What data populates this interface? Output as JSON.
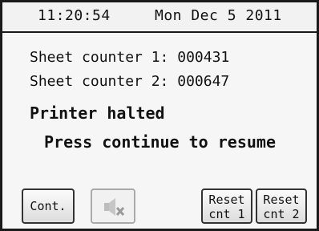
{
  "header": {
    "time": "11:20:54",
    "date": "Mon Dec 5 2011"
  },
  "counters": {
    "counter1_label": "Sheet counter 1: 000431",
    "counter2_label": "Sheet counter 2: 000647"
  },
  "status": {
    "message": "Printer halted",
    "instruction": "Press continue to resume"
  },
  "buttons": {
    "continue_label": "Cont.",
    "mute_icon": "speaker-muted-icon",
    "reset1_line1": "Reset",
    "reset1_line2": "cnt 1",
    "reset2_line1": "Reset",
    "reset2_line2": "cnt 2"
  },
  "colors": {
    "border": "#1a1a1a",
    "background": "#f6f6f6",
    "disabled_icon": "#b8b8b8"
  }
}
